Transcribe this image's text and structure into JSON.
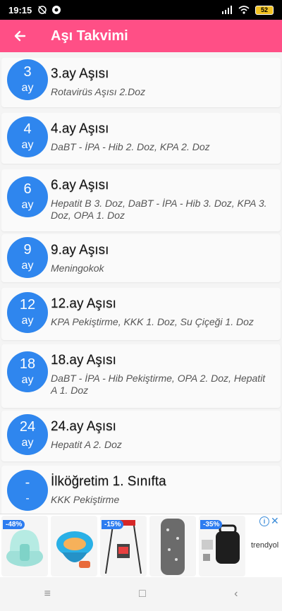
{
  "status": {
    "time": "19:15",
    "battery": "52"
  },
  "header": {
    "title": "Aşı Takvimi"
  },
  "items": [
    {
      "num": "3",
      "unit": "ay",
      "title": "3.ay Aşısı",
      "desc": "Rotavirüs Aşısı 2.Doz"
    },
    {
      "num": "4",
      "unit": "ay",
      "title": "4.ay Aşısı",
      "desc": "DaBT - İPA - Hib 2. Doz, KPA 2. Doz"
    },
    {
      "num": "6",
      "unit": "ay",
      "title": "6.ay Aşısı",
      "desc": "Hepatit B 3. Doz, DaBT - İPA - Hib 3. Doz, KPA 3. Doz, OPA 1. Doz"
    },
    {
      "num": "9",
      "unit": "ay",
      "title": "9.ay Aşısı",
      "desc": "Meningokok"
    },
    {
      "num": "12",
      "unit": "ay",
      "title": "12.ay Aşısı",
      "desc": "KPA Pekiştirme, KKK 1. Doz, Su Çiçeği 1. Doz"
    },
    {
      "num": "18",
      "unit": "ay",
      "title": "18.ay Aşısı",
      "desc": "DaBT - İPA - Hib Pekiştirme, OPA 2. Doz, Hepatit A 1. Doz"
    },
    {
      "num": "24",
      "unit": "ay",
      "title": "24.ay Aşısı",
      "desc": "Hepatit A 2. Doz"
    },
    {
      "num": "-",
      "unit": "-",
      "title": "İlköğretim 1. Sınıfta",
      "desc": "KKK Pekiştirme"
    }
  ],
  "ad": {
    "discounts": [
      "-48%",
      "-15%",
      "-35%"
    ],
    "brand": "trendyol",
    "info": "i",
    "close": "✕"
  },
  "nav": {
    "menu": "≡",
    "home": "□",
    "back": "‹"
  }
}
